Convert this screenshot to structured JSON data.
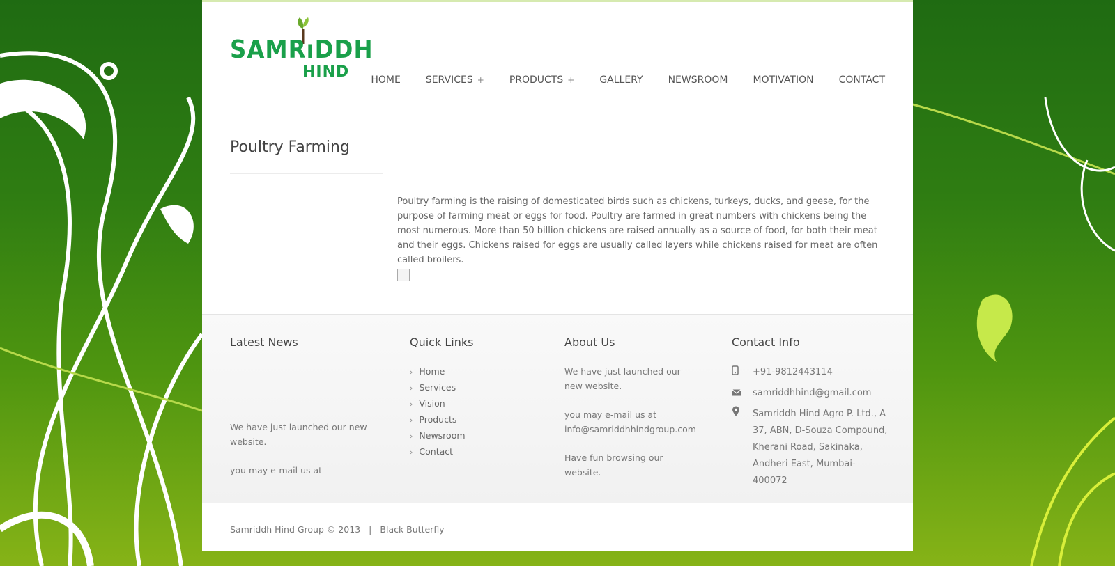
{
  "logo": {
    "line1": "SAMRıDDH",
    "line2": "HIND"
  },
  "nav": [
    {
      "label": "HOME",
      "plus": ""
    },
    {
      "label": "SERVICES",
      "plus": "+"
    },
    {
      "label": "PRODUCTS",
      "plus": "+"
    },
    {
      "label": "GALLERY",
      "plus": ""
    },
    {
      "label": "NEWSROOM",
      "plus": ""
    },
    {
      "label": "MOTIVATION",
      "plus": ""
    },
    {
      "label": "CONTACT",
      "plus": ""
    }
  ],
  "page": {
    "title": "Poultry Farming",
    "body": "Poultry farming is the raising of domesticated birds such as chickens, turkeys, ducks, and geese, for the purpose of farming meat or eggs for food. Poultry are farmed in great numbers with chickens being the most numerous. More than 50 billion chickens are raised annually as a source of food, for both their meat and their eggs. Chickens raised for eggs are usually called layers while chickens raised for meat are often called broilers."
  },
  "footer": {
    "latest_news": {
      "title": "Latest News",
      "p1": "We have just launched our new website.",
      "p2": "you may e-mail us at"
    },
    "quick_links": {
      "title": "Quick Links",
      "items": [
        "Home",
        "Services",
        "Vision",
        "Products",
        "Newsroom",
        "Contact"
      ]
    },
    "about": {
      "title": "About Us",
      "p1": "We have just launched our new website.",
      "p2": "you may e-mail us at info@samriddhhindgroup.com",
      "p3": "Have fun browsing our website."
    },
    "contact": {
      "title": "Contact Info",
      "phone": "+91-9812443114",
      "email": "samriddhhind@gmail.com",
      "address": "Samriddh Hind Agro P. Ltd., A 37, ABN, D-Souza Compound, Kherani Road, Sakinaka, Andheri East, Mumbai- 400072"
    }
  },
  "bottom": {
    "copyright": "Samriddh Hind Group © 2013",
    "separator": "|",
    "credit": "Black Butterfly"
  },
  "colors": {
    "brand_green": "#1aa04a",
    "bg_dark": "#1f6b12",
    "bg_light": "#86b317"
  },
  "icons": {
    "phone": "mobile-phone-icon",
    "email": "envelope-icon",
    "address": "map-pin-icon",
    "link": "chevron-right-icon"
  }
}
